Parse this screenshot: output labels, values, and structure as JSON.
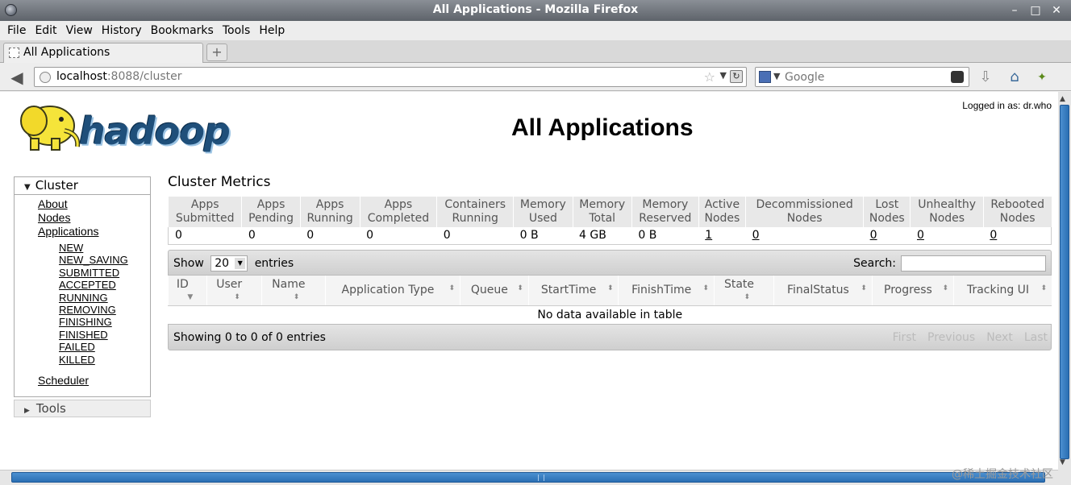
{
  "window": {
    "title": "All Applications - Mozilla Firefox"
  },
  "menubar": [
    "File",
    "Edit",
    "View",
    "History",
    "Bookmarks",
    "Tools",
    "Help"
  ],
  "tab": {
    "label": "All Applications"
  },
  "nav": {
    "url_host": "localhost",
    "url_path": ":8088/cluster",
    "search_placeholder": "Google"
  },
  "page": {
    "logged_in": "Logged in as: dr.who",
    "title": "All Applications",
    "logo_text": "hadoop"
  },
  "sidebar": {
    "cluster_label": "Cluster",
    "links": [
      "About",
      "Nodes",
      "Applications"
    ],
    "states": [
      "NEW",
      "NEW_SAVING",
      "SUBMITTED",
      "ACCEPTED",
      "RUNNING",
      "REMOVING",
      "FINISHING",
      "FINISHED",
      "FAILED",
      "KILLED"
    ],
    "scheduler": "Scheduler",
    "tools_label": "Tools"
  },
  "metrics": {
    "title": "Cluster Metrics",
    "headers": [
      [
        "Apps",
        "Submitted"
      ],
      [
        "Apps",
        "Pending"
      ],
      [
        "Apps",
        "Running"
      ],
      [
        "Apps",
        "Completed"
      ],
      [
        "Containers",
        "Running"
      ],
      [
        "Memory",
        "Used"
      ],
      [
        "Memory",
        "Total"
      ],
      [
        "Memory",
        "Reserved"
      ],
      [
        "Active",
        "Nodes"
      ],
      [
        "Decommissioned",
        "Nodes"
      ],
      [
        "Lost",
        "Nodes"
      ],
      [
        "Unhealthy",
        "Nodes"
      ],
      [
        "Rebooted",
        "Nodes"
      ]
    ],
    "values": [
      "0",
      "0",
      "0",
      "0",
      "0",
      "0 B",
      "4 GB",
      "0 B",
      "1",
      "0",
      "0",
      "0",
      "0"
    ],
    "linked": [
      false,
      false,
      false,
      false,
      false,
      false,
      false,
      false,
      true,
      true,
      true,
      true,
      true
    ]
  },
  "table": {
    "show_label": "Show",
    "entries_value": "20",
    "entries_label": "entries",
    "search_label": "Search:",
    "columns": [
      "ID",
      "User",
      "Name",
      "Application Type",
      "Queue",
      "StartTime",
      "FinishTime",
      "State",
      "FinalStatus",
      "Progress",
      "Tracking UI"
    ],
    "stacked": [
      true,
      true,
      true,
      false,
      false,
      false,
      false,
      true,
      false,
      false,
      false
    ],
    "empty": "No data available in table",
    "info": "Showing 0 to 0 of 0 entries",
    "pager": [
      "First",
      "Previous",
      "Next",
      "Last"
    ]
  },
  "watermark": "@稀土掘金技术社区"
}
